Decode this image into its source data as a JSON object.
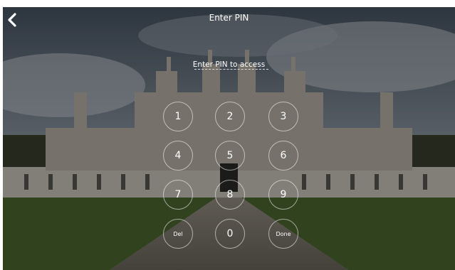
{
  "header": {
    "title": "Enter PIN",
    "back_icon": "chevron-left-icon"
  },
  "prompt": {
    "label": "Enter PIN to access"
  },
  "keypad": {
    "rows": [
      [
        "1",
        "2",
        "3"
      ],
      [
        "4",
        "5",
        "6"
      ],
      [
        "7",
        "8",
        "9"
      ],
      [
        "Del",
        "0",
        "Done"
      ]
    ]
  },
  "colors": {
    "overlay": "#000000",
    "text": "#ffffff",
    "key_border": "#ffffff"
  }
}
